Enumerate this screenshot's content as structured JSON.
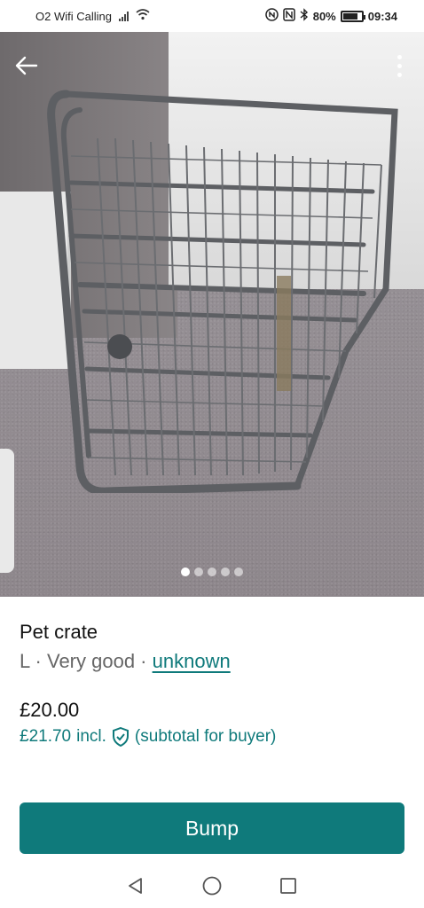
{
  "status_bar": {
    "carrier": "O2 Wifi Calling",
    "battery": "80%",
    "battery_level": 0.8,
    "time": "09:34"
  },
  "gallery": {
    "image_count": 5,
    "active_index": 0
  },
  "listing": {
    "title": "Pet crate",
    "size": "L",
    "condition": "Very good",
    "brand": "unknown",
    "separator": " · ",
    "price": "£20.00",
    "buyer_price": "£21.70",
    "buyer_price_incl": "incl.",
    "buyer_price_note": "(subtotal for buyer)"
  },
  "actions": {
    "bump_label": "Bump"
  },
  "colors": {
    "accent": "#0f7a7b"
  },
  "icons": {
    "back": "arrow-left-icon",
    "more": "more-vertical-icon",
    "shield": "shield-check-icon",
    "nav_back": "triangle-back-icon",
    "nav_home": "circle-home-icon",
    "nav_recents": "square-recents-icon"
  }
}
